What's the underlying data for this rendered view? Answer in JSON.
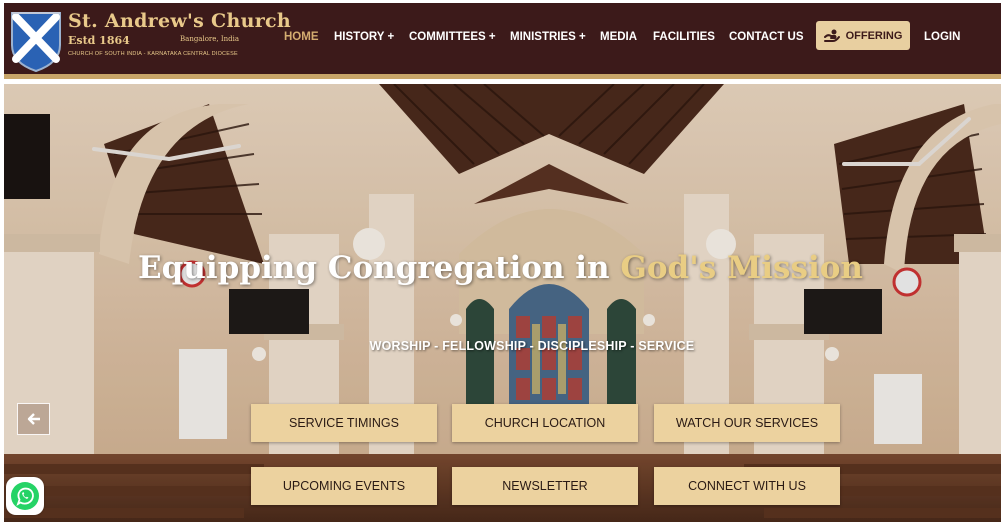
{
  "brand": {
    "title": "St. Andrew's Church",
    "estd": "Estd 1864",
    "city": "Bangalore, India",
    "diocese": "CHURCH OF SOUTH INDIA - KARNATAKA CENTRAL DIOCESE"
  },
  "nav": {
    "home": "HOME",
    "history": "HISTORY +",
    "committees": "COMMITTEES +",
    "ministries": "MINISTRIES +",
    "media": "MEDIA",
    "facilities": "FACILITIES",
    "contact": "CONTACT US",
    "offering": "OFFERING",
    "login": "LOGIN"
  },
  "hero": {
    "headline_part1": "Equipping Congregation in ",
    "headline_part2": "God's Mission",
    "tagline": "WORSHIP - FELLOWSHIP - DISCIPLESHIP - SERVICE"
  },
  "buttons": {
    "service_timings": "SERVICE TIMINGS",
    "church_location": "CHURCH LOCATION",
    "watch_services": "WATCH OUR SERVICES",
    "upcoming_events": "UPCOMING EVENTS",
    "newsletter": "NEWSLETTER",
    "connect": "CONNECT WITH US"
  },
  "icons": {
    "logo": "st-andrews-cross-shield",
    "offering": "giving-hand-icon",
    "prev": "arrow-left-icon",
    "whatsapp": "whatsapp-icon"
  },
  "colors": {
    "header_bg": "#3c1a1a",
    "gold_accent": "#c8a569",
    "active_nav": "#d4ad70",
    "button_bg": "#ecd29f",
    "headline_gold": "#e9cd84",
    "whatsapp_green": "#25d366"
  }
}
